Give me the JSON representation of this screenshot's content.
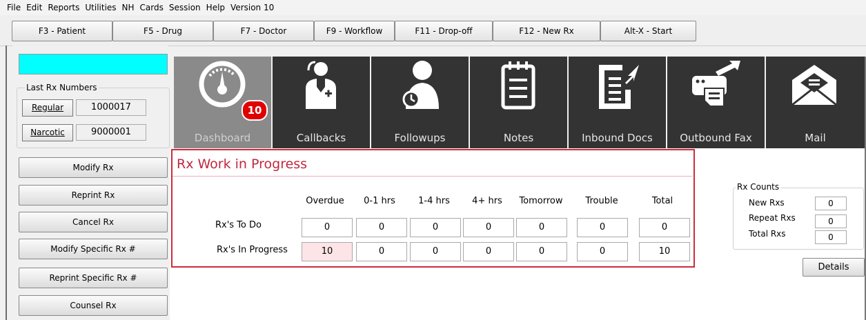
{
  "menu": [
    "File",
    "Edit",
    "Reports",
    "Utilities",
    "NH",
    "Cards",
    "Session",
    "Help",
    "Version 10"
  ],
  "fkeys": [
    "F3 - Patient",
    "F5 - Drug",
    "F7 - Doctor",
    "F9 - Workflow",
    "F11 - Drop-off",
    "F12 - New Rx",
    "Alt-X - Start"
  ],
  "sidebar": {
    "last_rx_title": "Last Rx Numbers",
    "regular_label": "Regular",
    "regular_value": "1000017",
    "narcotic_label": "Narcotic",
    "narcotic_value": "9000001",
    "buttons": [
      "Modify Rx",
      "Reprint Rx",
      "Cancel Rx",
      "Modify Specific Rx #",
      "Reprint Specific Rx #",
      "Counsel Rx"
    ]
  },
  "tiles": [
    {
      "label": "Dashboard",
      "icon": "speedometer-icon",
      "badge": "10"
    },
    {
      "label": "Callbacks",
      "icon": "doctor-icon"
    },
    {
      "label": "Followups",
      "icon": "person-clock-icon"
    },
    {
      "label": "Notes",
      "icon": "notepad-icon"
    },
    {
      "label": "Inbound Docs",
      "icon": "inbound-document-icon"
    },
    {
      "label": "Outbound Fax",
      "icon": "fax-icon"
    },
    {
      "label": "Mail",
      "icon": "mail-icon"
    }
  ],
  "wip": {
    "title": "Rx Work in Progress",
    "columns": [
      "Overdue",
      "0-1 hrs",
      "1-4 hrs",
      "4+ hrs",
      "Tomorrow",
      "Trouble",
      "Total"
    ],
    "rows": [
      {
        "label": "Rx's To Do",
        "values": [
          "0",
          "0",
          "0",
          "0",
          "0",
          "0",
          "0"
        ]
      },
      {
        "label": "Rx's In Progress",
        "values": [
          "10",
          "0",
          "0",
          "0",
          "0",
          "0",
          "10"
        ]
      }
    ],
    "highlight_color": "#fde4e6",
    "border_color": "#cc2b3b"
  },
  "rx_counts": {
    "title": "Rx Counts",
    "items": [
      {
        "label": "New Rxs",
        "value": "0"
      },
      {
        "label": "Repeat Rxs",
        "value": "0"
      },
      {
        "label": "Total Rxs",
        "value": "0"
      }
    ],
    "details_label": "Details"
  }
}
